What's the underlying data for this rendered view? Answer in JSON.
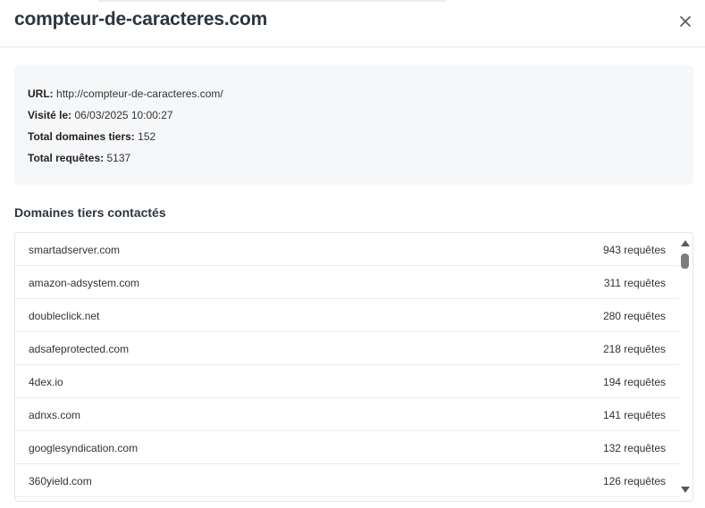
{
  "modal": {
    "title": "compteur-de-caracteres.com",
    "close_icon": "close-icon"
  },
  "info": {
    "url_label": "URL:",
    "url_value": "http://compteur-de-caracteres.com/",
    "visited_label": "Visité le:",
    "visited_value": "06/03/2025 10:00:27",
    "domains_label": "Total domaines tiers:",
    "domains_value": "152",
    "requests_label": "Total requêtes:",
    "requests_value": "5137"
  },
  "section": {
    "title": "Domaines tiers contactés"
  },
  "domains": [
    {
      "name": "smartadserver.com",
      "count": "943 requêtes"
    },
    {
      "name": "amazon-adsystem.com",
      "count": "311 requêtes"
    },
    {
      "name": "doubleclick.net",
      "count": "280 requêtes"
    },
    {
      "name": "adsafeprotected.com",
      "count": "218 requêtes"
    },
    {
      "name": "4dex.io",
      "count": "194 requêtes"
    },
    {
      "name": "adnxs.com",
      "count": "141 requêtes"
    },
    {
      "name": "googlesyndication.com",
      "count": "132 requêtes"
    },
    {
      "name": "360yield.com",
      "count": "126 requêtes"
    }
  ]
}
